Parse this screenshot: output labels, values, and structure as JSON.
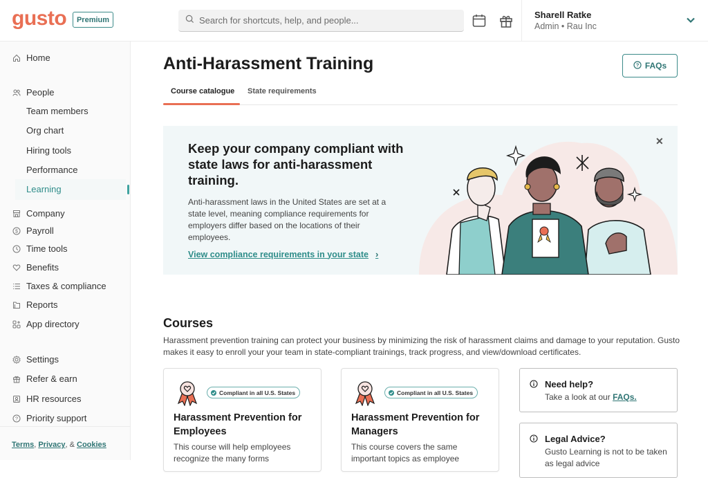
{
  "brand": {
    "logo": "gusto",
    "plan_badge": "Premium",
    "accent": "#e96f54",
    "teal": "#2f7574"
  },
  "header": {
    "search_placeholder": "Search for shortcuts, help, and people...",
    "icons": [
      "calendar-icon",
      "gift-icon"
    ],
    "user": {
      "name": "Sharell Ratke",
      "role": "Admin • Rau Inc"
    }
  },
  "sidebar": {
    "home": "Home",
    "people": "People",
    "people_sub": [
      "Team members",
      "Org chart",
      "Hiring tools",
      "Performance",
      "Learning"
    ],
    "active": "Learning",
    "sections": [
      "Company",
      "Payroll",
      "Time tools",
      "Benefits",
      "Taxes & compliance",
      "Reports",
      "App directory"
    ],
    "bottom": [
      "Settings",
      "Refer & earn",
      "HR resources",
      "Priority support"
    ],
    "footer": {
      "terms": "Terms",
      "privacy": "Privacy",
      "cookies": "Cookies",
      "sep1": ",",
      "sep2": ", &"
    }
  },
  "main": {
    "title": "Anti-Harassment Training",
    "faq_button": "FAQs",
    "tabs": [
      {
        "label": "Course catalogue",
        "active": true
      },
      {
        "label": "State requirements",
        "active": false
      }
    ],
    "banner": {
      "title": "Keep your company compliant with state laws for anti-harassment training.",
      "body": "Anti-harassment laws in the United States are set at a state level, meaning compliance requirements for employers differ based on the locations of their employees.",
      "link": "View compliance requirements in your state"
    },
    "courses": {
      "title": "Courses",
      "description": "Harassment prevention training can protect your business by minimizing the risk of harassment claims and damage to your reputation. Gusto makes it easy to enroll your your team in state-compliant trainings, track progress, and view/download certificates.",
      "cards": [
        {
          "badge": "Compliant in all U.S. States",
          "title": "Harassment Prevention for Employees",
          "desc": "This course will help employees recognize the many forms"
        },
        {
          "badge": "Compliant in all U.S. States",
          "title": "Harassment Prevention for Managers",
          "desc": "This course covers the same important topics as employee"
        }
      ]
    },
    "help_cards": [
      {
        "title": "Need help?",
        "body": "Take a look at our ",
        "link": "FAQs."
      },
      {
        "title": "Legal Advice?",
        "body": "Gusto Learning is not to be taken as legal advice"
      }
    ]
  }
}
